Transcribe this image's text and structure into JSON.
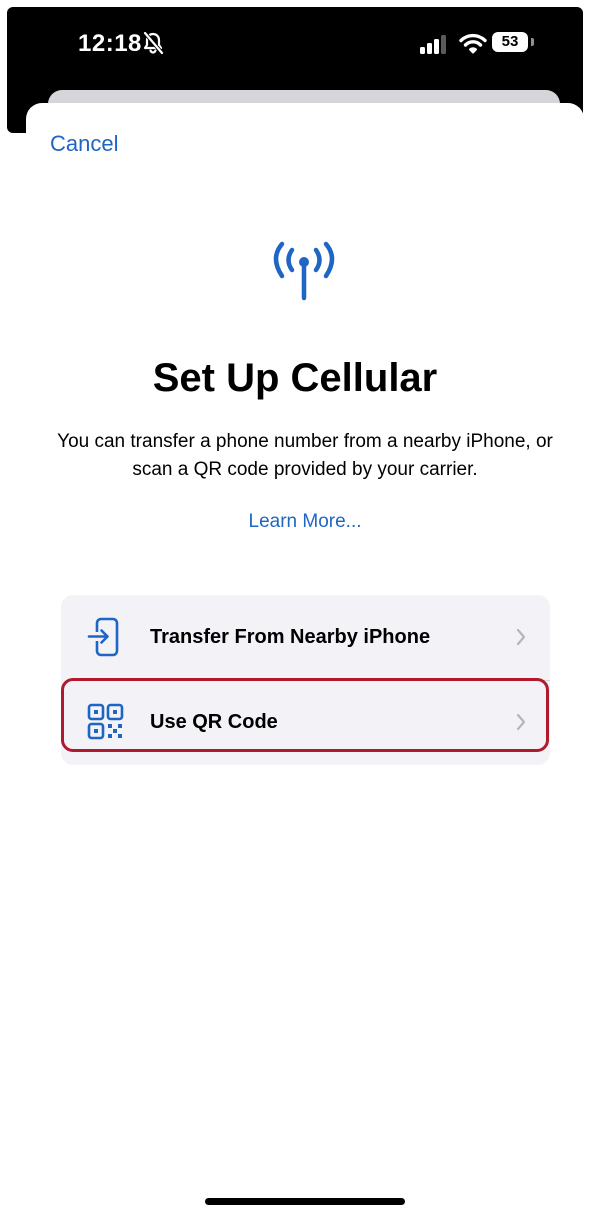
{
  "status_bar": {
    "time": "12:18",
    "battery_percent": "53",
    "silent_mode_icon": "bell-slash-icon",
    "signal_icon": "cellular-signal-icon",
    "wifi_icon": "wifi-icon"
  },
  "nav": {
    "cancel_label": "Cancel"
  },
  "header": {
    "icon": "antenna-radiowaves-icon",
    "title": "Set Up Cellular",
    "description": "You can transfer a phone number from a nearby iPhone, or scan a QR code provided by your carrier.",
    "learn_more_label": "Learn More..."
  },
  "options": [
    {
      "label": "Transfer From Nearby iPhone",
      "icon": "phone-transfer-icon"
    },
    {
      "label": "Use QR Code",
      "icon": "qr-code-icon",
      "highlighted": true
    }
  ],
  "colors": {
    "accent": "#1f66c4",
    "highlight_border": "#b01a2c",
    "list_background": "#f2f2f7"
  }
}
